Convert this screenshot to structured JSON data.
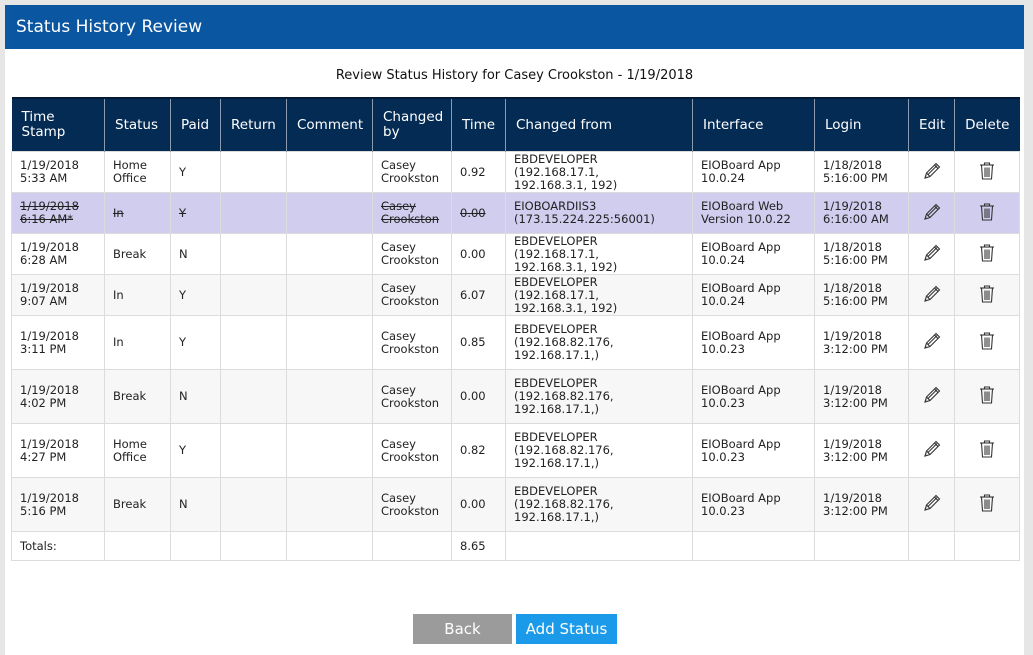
{
  "header": {
    "title": "Status History Review"
  },
  "subtitle": "Review Status History for Casey Crookston - 1/19/2018",
  "table": {
    "columns": [
      "Time Stamp",
      "Status",
      "Paid",
      "Return",
      "Comment",
      "Changed by",
      "Time",
      "Changed from",
      "Interface",
      "Login",
      "Edit",
      "Delete"
    ],
    "rows": [
      {
        "timestamp": [
          "1/19/2018",
          "5:33 AM"
        ],
        "status": [
          "Home",
          "Office"
        ],
        "paid": "Y",
        "return": "",
        "comment": "",
        "changed_by": [
          "Casey",
          "Crookston"
        ],
        "time": "0.92",
        "changed_from": [
          "EBDEVELOPER (192.168.17.1,",
          "192.168.3.1, 192)"
        ],
        "interface": [
          "EIOBoard App",
          "10.0.24"
        ],
        "login": [
          "1/18/2018",
          "5:16:00 PM"
        ],
        "deleted": false
      },
      {
        "timestamp": [
          "1/19/2018",
          "6:16 AM*"
        ],
        "status": [
          "In",
          ""
        ],
        "paid": "Y",
        "return": "",
        "comment": "",
        "changed_by": [
          "Casey",
          "Crookston"
        ],
        "time": "0.00",
        "changed_from": [
          "EIOBOARDIIS3",
          "(173.15.224.225:56001)"
        ],
        "interface": [
          "EIOBoard Web",
          "Version 10.0.22"
        ],
        "login": [
          "1/19/2018",
          "6:16:00 AM"
        ],
        "deleted": true
      },
      {
        "timestamp": [
          "1/19/2018",
          "6:28 AM"
        ],
        "status": [
          "Break",
          ""
        ],
        "paid": "N",
        "return": "",
        "comment": "",
        "changed_by": [
          "Casey",
          "Crookston"
        ],
        "time": "0.00",
        "changed_from": [
          "EBDEVELOPER (192.168.17.1,",
          "192.168.3.1, 192)"
        ],
        "interface": [
          "EIOBoard App",
          "10.0.24"
        ],
        "login": [
          "1/18/2018",
          "5:16:00 PM"
        ],
        "deleted": false
      },
      {
        "timestamp": [
          "1/19/2018",
          "9:07 AM"
        ],
        "status": [
          "In",
          ""
        ],
        "paid": "Y",
        "return": "",
        "comment": "",
        "changed_by": [
          "Casey",
          "Crookston"
        ],
        "time": "6.07",
        "changed_from": [
          "EBDEVELOPER (192.168.17.1,",
          "192.168.3.1, 192)"
        ],
        "interface": [
          "EIOBoard App",
          "10.0.24"
        ],
        "login": [
          "1/18/2018",
          "5:16:00 PM"
        ],
        "deleted": false
      },
      {
        "timestamp": [
          "1/19/2018",
          "3:11 PM"
        ],
        "status": [
          "In",
          ""
        ],
        "paid": "Y",
        "return": "",
        "comment": "",
        "changed_by": [
          "Casey",
          "Crookston"
        ],
        "time": "0.85",
        "changed_from": [
          "EBDEVELOPER",
          "(192.168.82.176,",
          "192.168.17.1,)"
        ],
        "interface": [
          "EIOBoard App",
          "10.0.23"
        ],
        "login": [
          "1/19/2018",
          "3:12:00 PM"
        ],
        "deleted": false
      },
      {
        "timestamp": [
          "1/19/2018",
          "4:02 PM"
        ],
        "status": [
          "Break",
          ""
        ],
        "paid": "N",
        "return": "",
        "comment": "",
        "changed_by": [
          "Casey",
          "Crookston"
        ],
        "time": "0.00",
        "changed_from": [
          "EBDEVELOPER",
          "(192.168.82.176,",
          "192.168.17.1,)"
        ],
        "interface": [
          "EIOBoard App",
          "10.0.23"
        ],
        "login": [
          "1/19/2018",
          "3:12:00 PM"
        ],
        "deleted": false
      },
      {
        "timestamp": [
          "1/19/2018",
          "4:27 PM"
        ],
        "status": [
          "Home",
          "Office"
        ],
        "paid": "Y",
        "return": "",
        "comment": "",
        "changed_by": [
          "Casey",
          "Crookston"
        ],
        "time": "0.82",
        "changed_from": [
          "EBDEVELOPER",
          "(192.168.82.176,",
          "192.168.17.1,)"
        ],
        "interface": [
          "EIOBoard App",
          "10.0.23"
        ],
        "login": [
          "1/19/2018",
          "3:12:00 PM"
        ],
        "deleted": false
      },
      {
        "timestamp": [
          "1/19/2018",
          "5:16 PM"
        ],
        "status": [
          "Break",
          ""
        ],
        "paid": "N",
        "return": "",
        "comment": "",
        "changed_by": [
          "Casey",
          "Crookston"
        ],
        "time": "0.00",
        "changed_from": [
          "EBDEVELOPER",
          "(192.168.82.176,",
          "192.168.17.1,)"
        ],
        "interface": [
          "EIOBoard App",
          "10.0.23"
        ],
        "login": [
          "1/19/2018",
          "3:12:00 PM"
        ],
        "deleted": false
      }
    ],
    "totals": {
      "label": "Totals:",
      "time": "8.65"
    },
    "icons": {
      "edit": "pencil-icon",
      "delete": "trash-icon"
    }
  },
  "buttons": {
    "back": "Back",
    "add_status": "Add Status"
  },
  "colors": {
    "header_bg": "#0b56a0",
    "table_header_bg": "#042b54",
    "deleted_row_bg": "#d0cdee",
    "back_button": "#9b9b9b",
    "add_button": "#1a9ae8"
  }
}
